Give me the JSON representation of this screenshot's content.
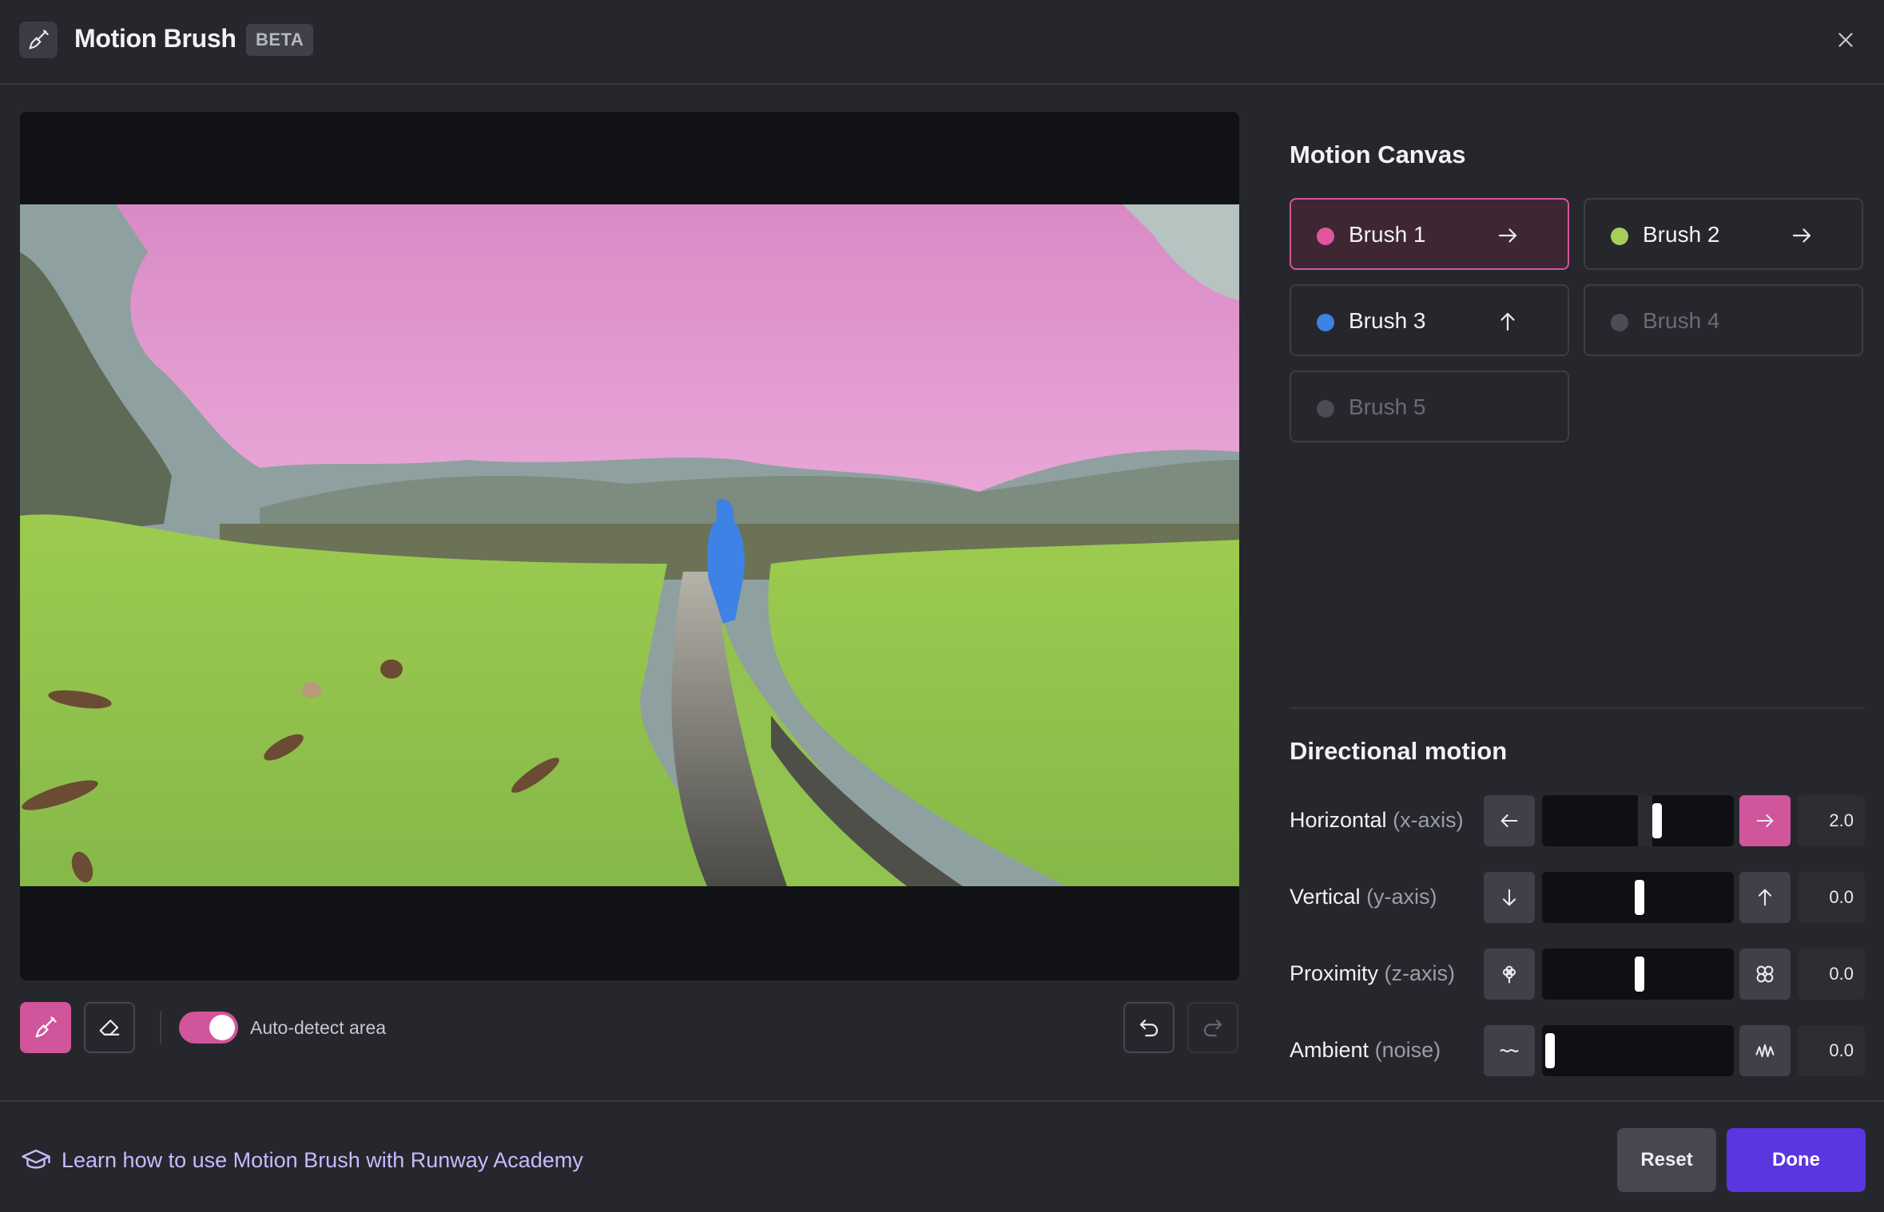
{
  "header": {
    "title": "Motion Brush",
    "badge": "BETA",
    "app_icon": "paintbrush-icon",
    "close_icon": "close-icon"
  },
  "canvas": {
    "toolbar": {
      "brush_tool_icon": "paintbrush-icon",
      "eraser_tool_icon": "eraser-icon",
      "auto_detect_label": "Auto-detect area",
      "auto_detect_on": true,
      "undo_icon": "undo-icon",
      "redo_icon": "redo-icon"
    }
  },
  "panel": {
    "motion_canvas_title": "Motion Canvas",
    "brushes": [
      {
        "name": "Brush 1",
        "color": "#e0559d",
        "direction": "right-arrow-icon",
        "active": true,
        "enabled": true
      },
      {
        "name": "Brush 2",
        "color": "#a6cf5a",
        "direction": "right-arrow-icon",
        "active": false,
        "enabled": true
      },
      {
        "name": "Brush 3",
        "color": "#3f82e6",
        "direction": "up-arrow-icon",
        "active": false,
        "enabled": true
      },
      {
        "name": "Brush 4",
        "color": "#4b4c55",
        "direction": "",
        "active": false,
        "enabled": false
      },
      {
        "name": "Brush 5",
        "color": "#4b4c55",
        "direction": "",
        "active": false,
        "enabled": false
      }
    ],
    "directional_title": "Directional motion",
    "sliders": [
      {
        "label": "Horizontal",
        "axis": "(x-axis)",
        "value": "2.0",
        "position": 0.6,
        "left_icon": "left-arrow-icon",
        "right_icon": "right-arrow-icon",
        "right_active": true
      },
      {
        "label": "Vertical",
        "axis": "(y-axis)",
        "value": "0.0",
        "position": 0.5,
        "left_icon": "down-arrow-icon",
        "right_icon": "up-arrow-icon",
        "right_active": false
      },
      {
        "label": "Proximity",
        "axis": "(z-axis)",
        "value": "0.0",
        "position": 0.5,
        "left_icon": "zoom-out-flower-icon",
        "right_icon": "zoom-in-flower-icon",
        "right_active": false
      },
      {
        "label": "Ambient",
        "axis": "(noise)",
        "value": "0.0",
        "position": 0.0,
        "left_icon": "wave-low-icon",
        "right_icon": "wave-high-icon",
        "right_active": false
      }
    ]
  },
  "footer": {
    "academy_icon": "graduation-cap-icon",
    "academy_link": "Learn how to use Motion Brush with Runway Academy",
    "reset_label": "Reset",
    "done_label": "Done"
  }
}
